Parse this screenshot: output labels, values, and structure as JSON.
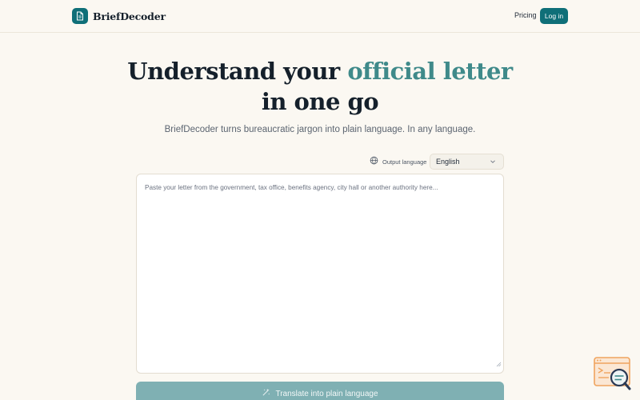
{
  "header": {
    "brand_name": "BriefDecoder",
    "nav_pricing": "Pricing",
    "login_label": "Log in"
  },
  "hero": {
    "title_part1": "Understand your ",
    "title_accent": "official letter",
    "title_part2": "in one go",
    "subtitle": "BriefDecoder turns bureaucratic jargon into plain language. In any language."
  },
  "language": {
    "label": "Output language",
    "selected": "English"
  },
  "letter_input": {
    "value": "",
    "placeholder": "Paste your letter from the government, tax office, benefits agency, city hall or another authority here..."
  },
  "translate_button": {
    "label": "Translate into plain language"
  },
  "colors": {
    "brand": "#0f6f78",
    "accent_text": "#3f8a8a",
    "background": "#fbf8f2",
    "button_disabled": "#7fb0b3"
  },
  "icons": {
    "logo": "document-icon",
    "language": "globe-icon",
    "dropdown": "chevron-down-icon",
    "translate": "sparkles-icon",
    "help_widget": "search-window-icon"
  }
}
